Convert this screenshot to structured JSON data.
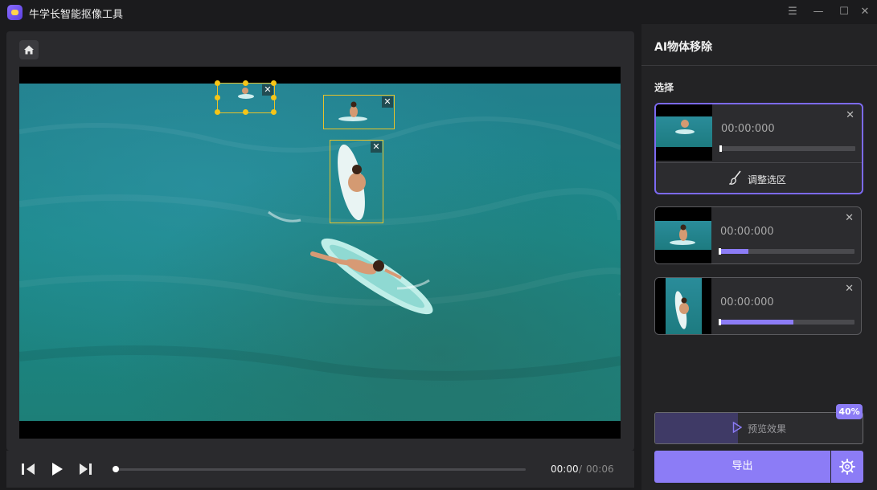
{
  "app": {
    "title": "牛学长智能抠像工具"
  },
  "window_controls": {
    "menu": "☰",
    "minimize": "—",
    "maximize": "☐",
    "close": "✕"
  },
  "player": {
    "current_time": "00:00",
    "separator": "/",
    "total_time": "00:06",
    "progress": 0.0
  },
  "sidebar": {
    "title": "AI物体移除",
    "section_label": "选择",
    "items": [
      {
        "time": "00:00:000",
        "progress": 0.0,
        "selected": true,
        "adjust_label": "调整选区"
      },
      {
        "time": "00:00:000",
        "progress": 0.22
      },
      {
        "time": "00:00:000",
        "progress": 0.55
      }
    ],
    "preview_label": "预览效果",
    "preview_progress": 0.4,
    "preview_badge": "40%",
    "export_label": "导出"
  },
  "colors": {
    "accent": "#8c7cf6",
    "selection": "#e8c22a",
    "background": "#1b1b1d"
  }
}
